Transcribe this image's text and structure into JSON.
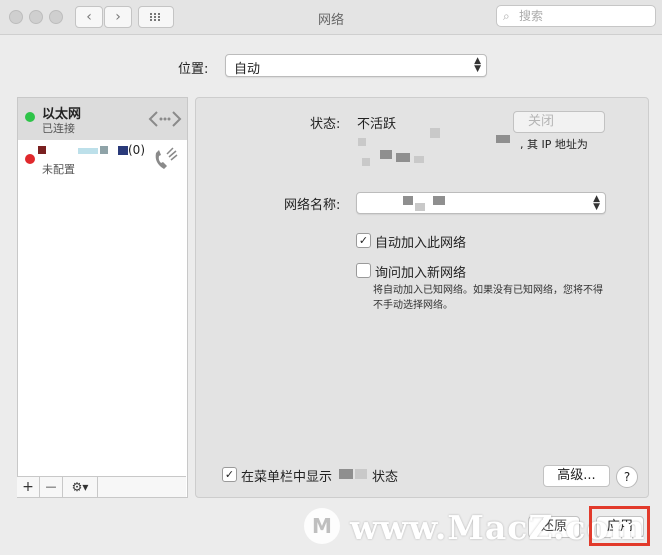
{
  "window": {
    "title": "网络",
    "search_placeholder": "搜索"
  },
  "location": {
    "label": "位置:",
    "value": "自动"
  },
  "services": [
    {
      "name": "以太网",
      "status": "已连接",
      "status_color": "#2ec449",
      "icon": "ethernet-arrows-icon"
    },
    {
      "name": "(0)",
      "status": "未配置",
      "status_color": "#e0282c",
      "icon": "phone-icon"
    }
  ],
  "sidebar_buttons": {
    "add": "+",
    "remove": "—",
    "gear": "⚙▾"
  },
  "details": {
    "status_label": "状态:",
    "status_value": "不活跃",
    "close_button": "关闭",
    "ip_text": ", 其 IP 地址为",
    "network_name_label": "网络名称:",
    "auto_join_label": "自动加入此网络",
    "auto_join_checked": "✓",
    "ask_join_label": "询问加入新网络",
    "note": "将自动加入已知网络。如果没有已知网络，您将不得不手动选择网络。",
    "menubar_checked": "✓",
    "menubar_label_pre": "在菜单栏中显示",
    "menubar_label_post": "状态",
    "advanced_button": "高级...",
    "help_button": "?"
  },
  "footer": {
    "revert_button": "还原",
    "apply_button": "应用"
  },
  "watermark": {
    "text": "www.MacZ.com",
    "logo": "M"
  },
  "colors": {
    "highlight": "#e23a2b"
  }
}
